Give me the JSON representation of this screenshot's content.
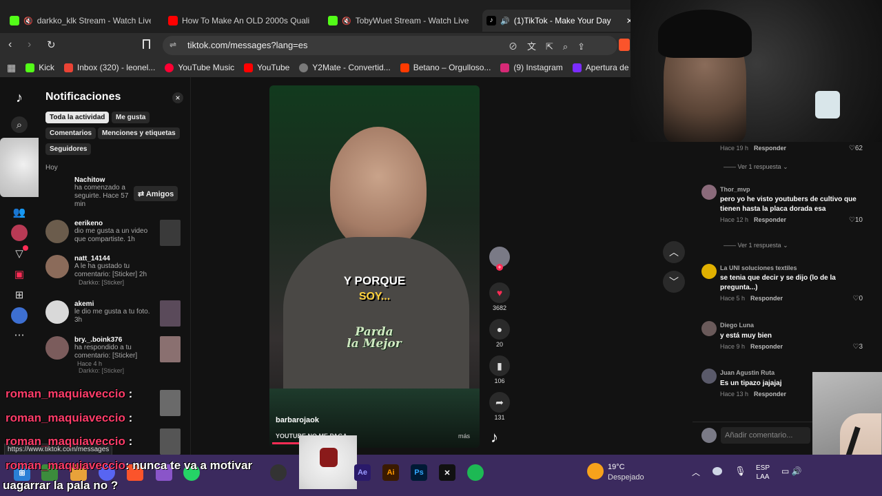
{
  "browser": {
    "tabs": [
      {
        "label": "darkko_klk Stream - Watch Live o",
        "icon": "kick-icon",
        "color": "#53fc18"
      },
      {
        "label": "How To Make An OLD 2000s Quality",
        "icon": "youtube-icon",
        "color": "#ff0000"
      },
      {
        "label": "TobyWuet Stream - Watch Live o",
        "icon": "kick-icon",
        "color": "#53fc18"
      },
      {
        "label": "(1)TikTok - Make Your Day",
        "icon": "tiktok-icon",
        "color": "#000000"
      }
    ],
    "tab_close": "×",
    "url": "tiktok.com/messages?lang=es",
    "bookmarks": [
      {
        "label": "Kick",
        "color": "#53fc18"
      },
      {
        "label": "Inbox (320) - leonel...",
        "color": "#ea4335"
      },
      {
        "label": "YouTube Music",
        "color": "#ff0033"
      },
      {
        "label": "YouTube",
        "color": "#ff0000"
      },
      {
        "label": "Y2Mate - Convertid...",
        "color": "#7a7a7a"
      },
      {
        "label": "Betano – Orgulloso...",
        "color": "#ff3a00"
      },
      {
        "label": "(9) Instagram",
        "color": "#d62976"
      },
      {
        "label": "Apertura de",
        "color": "#7b2cff"
      }
    ],
    "status_url": "https://www.tiktok.com/messages"
  },
  "notifications": {
    "title": "Notificaciones",
    "close": "×",
    "filters": [
      "Toda la actividad",
      "Me gusta",
      "Comentarios",
      "Menciones y etiquetas",
      "Seguidores"
    ],
    "section_today": "Hoy",
    "items": [
      {
        "user": "Nachitow",
        "text": "ha comenzado a seguirte. Hace 57 min",
        "button": "⇄ Amigos"
      },
      {
        "user": "eerikeno",
        "text": "dio me gusta a un video que compartiste. 1h"
      },
      {
        "user": "natt_14144",
        "text": "A le ha gustado tu comentario: [Sticker] 2h",
        "sub": "Darkko: [Sticker]"
      },
      {
        "user": "akemi",
        "text": "le dio me gusta a tu foto. 3h"
      },
      {
        "user": "bry._.boink376",
        "text": "ha respondido a tu comentario: [Sticker]",
        "sub": "Hace 4 h",
        "sub2": "Darkko: [Sticker]"
      }
    ]
  },
  "video": {
    "caption1": "Y PORQUE",
    "caption2": "SOY...",
    "logo_line1": "Parda",
    "logo_line2": "la Mejor",
    "author": "barbarojaok",
    "description": "YOUTUBE NO ME PAGA...",
    "more": "más"
  },
  "actions": {
    "likes": "3682",
    "comments": "20",
    "saves": "106",
    "shares": "131"
  },
  "comments": [
    {
      "user": "",
      "text": "",
      "time": "Hace 19 h",
      "reply": "Responder",
      "likes": "62"
    },
    {
      "more": "Ver 1 respuesta"
    },
    {
      "user": "Thor_mvp",
      "text": "pero yo he visto youtubers de cultivo que tienen hasta la placa dorada esa",
      "time": "Hace 12 h",
      "reply": "Responder",
      "likes": "10"
    },
    {
      "more": "Ver 1 respuesta"
    },
    {
      "user": "La UNI soluciones textiles",
      "text": "se tenia que decir y se dijo (lo de la pregunta...)",
      "time": "Hace 5 h",
      "reply": "Responder",
      "likes": "0"
    },
    {
      "user": "Diego Luna",
      "text": "y está muy bien",
      "time": "Hace 9 h",
      "reply": "Responder",
      "likes": "3"
    },
    {
      "user": "Juan Agustin Ruta",
      "text": "Es un tipazo jajajaj",
      "time": "Hace 13 h",
      "reply": "Responder",
      "likes": ""
    }
  ],
  "comment_input": {
    "placeholder": "Añadir comentario..."
  },
  "chat": {
    "user": "roman_maquiaveccio",
    "line4_msg": ": nunca te va a motivar",
    "line5": "uagarrar la pala no ?"
  },
  "taskbar": {
    "weather_temp": "19°C",
    "weather_desc": "Despejado",
    "lang1": "ESP",
    "lang2": "LAA"
  }
}
